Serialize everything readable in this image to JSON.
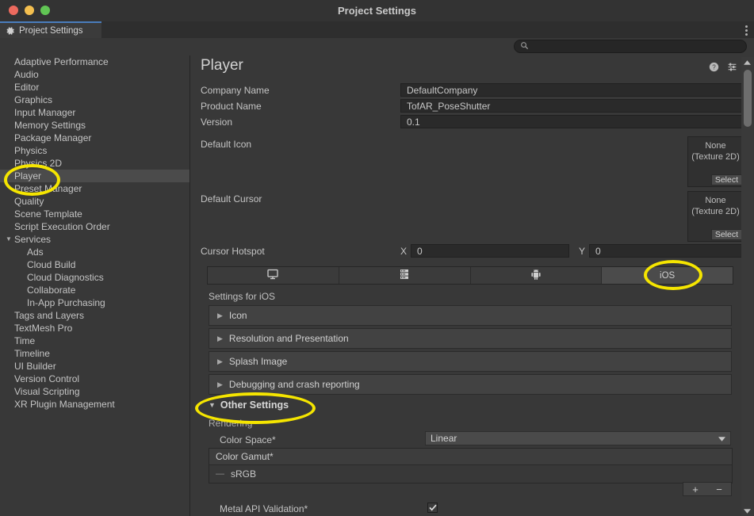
{
  "window": {
    "title": "Project Settings",
    "traffic_lights": [
      "close-red",
      "minimize-yellow",
      "maximize-green"
    ]
  },
  "tabbar": {
    "tab_label": "Project Settings",
    "tab_icon": "gear-icon",
    "overflow_icon": "kebab-menu-icon"
  },
  "search": {
    "value": "",
    "placeholder": "",
    "icon": "search-icon"
  },
  "sidebar": {
    "items": [
      {
        "label": "Adaptive Performance",
        "level": 0,
        "selected": false
      },
      {
        "label": "Audio",
        "level": 0,
        "selected": false
      },
      {
        "label": "Editor",
        "level": 0,
        "selected": false
      },
      {
        "label": "Graphics",
        "level": 0,
        "selected": false
      },
      {
        "label": "Input Manager",
        "level": 0,
        "selected": false
      },
      {
        "label": "Memory Settings",
        "level": 0,
        "selected": false
      },
      {
        "label": "Package Manager",
        "level": 0,
        "selected": false
      },
      {
        "label": "Physics",
        "level": 0,
        "selected": false
      },
      {
        "label": "Physics 2D",
        "level": 0,
        "selected": false
      },
      {
        "label": "Player",
        "level": 0,
        "selected": true
      },
      {
        "label": "Preset Manager",
        "level": 0,
        "selected": false
      },
      {
        "label": "Quality",
        "level": 0,
        "selected": false
      },
      {
        "label": "Scene Template",
        "level": 0,
        "selected": false
      },
      {
        "label": "Script Execution Order",
        "level": 0,
        "selected": false
      },
      {
        "label": "Services",
        "level": 0,
        "selected": false,
        "expanded": true
      },
      {
        "label": "Ads",
        "level": 1,
        "selected": false
      },
      {
        "label": "Cloud Build",
        "level": 1,
        "selected": false
      },
      {
        "label": "Cloud Diagnostics",
        "level": 1,
        "selected": false
      },
      {
        "label": "Collaborate",
        "level": 1,
        "selected": false
      },
      {
        "label": "In-App Purchasing",
        "level": 1,
        "selected": false
      },
      {
        "label": "Tags and Layers",
        "level": 0,
        "selected": false
      },
      {
        "label": "TextMesh Pro",
        "level": 0,
        "selected": false
      },
      {
        "label": "Time",
        "level": 0,
        "selected": false
      },
      {
        "label": "Timeline",
        "level": 0,
        "selected": false
      },
      {
        "label": "UI Builder",
        "level": 0,
        "selected": false
      },
      {
        "label": "Version Control",
        "level": 0,
        "selected": false
      },
      {
        "label": "Visual Scripting",
        "level": 0,
        "selected": false
      },
      {
        "label": "XR Plugin Management",
        "level": 0,
        "selected": false
      }
    ]
  },
  "main": {
    "title": "Player",
    "header_icons": [
      "help-icon",
      "preset-icon",
      "kebab-menu-icon"
    ],
    "fields": [
      {
        "label": "Company Name",
        "value": "DefaultCompany"
      },
      {
        "label": "Product Name",
        "value": "TofAR_PoseShutter"
      },
      {
        "label": "Version",
        "value": "0.1"
      }
    ],
    "default_icon": {
      "label": "Default Icon",
      "none_line1": "None",
      "none_line2": "(Texture 2D)",
      "select_label": "Select"
    },
    "default_cursor": {
      "label": "Default Cursor",
      "none_line1": "None",
      "none_line2": "(Texture 2D)",
      "select_label": "Select"
    },
    "cursor_hotspot": {
      "label": "Cursor Hotspot",
      "x_label": "X",
      "x_value": "0",
      "y_label": "Y",
      "y_value": "0"
    },
    "platform_tabs": [
      {
        "label": "",
        "icon": "desktop-monitor-icon",
        "active": false
      },
      {
        "label": "",
        "icon": "server-grid-icon",
        "active": false
      },
      {
        "label": "",
        "icon": "android-robot-icon",
        "active": false
      },
      {
        "label": "iOS",
        "icon": "",
        "active": true
      }
    ],
    "settings_for_label": "Settings for iOS",
    "foldouts": [
      {
        "label": "Icon",
        "expanded": false
      },
      {
        "label": "Resolution and Presentation",
        "expanded": false
      },
      {
        "label": "Splash Image",
        "expanded": false
      },
      {
        "label": "Debugging and crash reporting",
        "expanded": false
      }
    ],
    "other_settings": {
      "label": "Other Settings",
      "expanded": true,
      "rendering_label": "Rendering",
      "color_space": {
        "label": "Color Space*",
        "value": "Linear"
      },
      "color_gamut": {
        "label": "Color Gamut*",
        "items": [
          "sRGB"
        ],
        "add_label": "+",
        "remove_label": "−"
      },
      "metal_api_validation": {
        "label": "Metal API Validation*",
        "checked": true
      }
    }
  },
  "scrollbar": {
    "up_arrow": "triangle-up-icon",
    "down_arrow": "triangle-down-icon"
  },
  "annotations": {
    "highlight_color": "#f5e500",
    "highlights": [
      "player-sidebar-item",
      "ios-platform-tab",
      "other-settings-foldout"
    ]
  }
}
